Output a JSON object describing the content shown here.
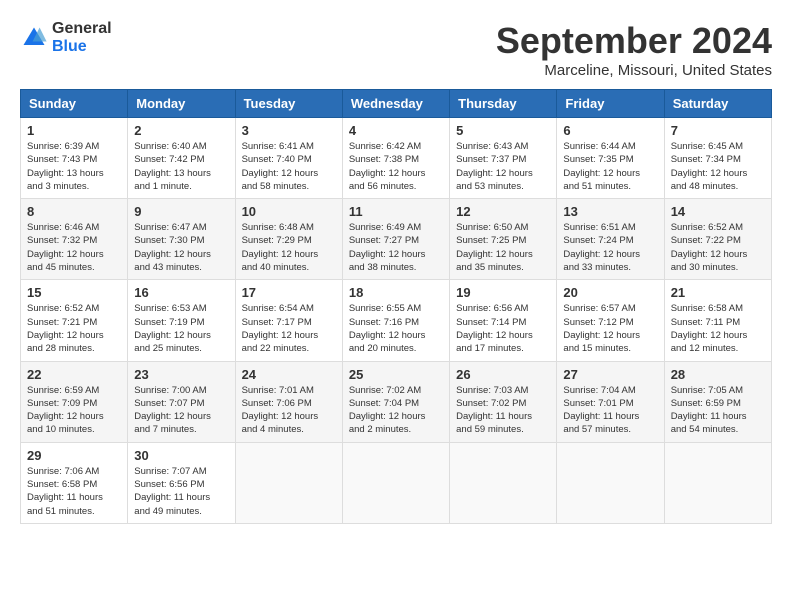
{
  "header": {
    "logo_general": "General",
    "logo_blue": "Blue",
    "month_title": "September 2024",
    "location": "Marceline, Missouri, United States"
  },
  "calendar": {
    "headers": [
      "Sunday",
      "Monday",
      "Tuesday",
      "Wednesday",
      "Thursday",
      "Friday",
      "Saturday"
    ],
    "weeks": [
      [
        {
          "day": "1",
          "info": "Sunrise: 6:39 AM\nSunset: 7:43 PM\nDaylight: 13 hours\nand 3 minutes."
        },
        {
          "day": "2",
          "info": "Sunrise: 6:40 AM\nSunset: 7:42 PM\nDaylight: 13 hours\nand 1 minute."
        },
        {
          "day": "3",
          "info": "Sunrise: 6:41 AM\nSunset: 7:40 PM\nDaylight: 12 hours\nand 58 minutes."
        },
        {
          "day": "4",
          "info": "Sunrise: 6:42 AM\nSunset: 7:38 PM\nDaylight: 12 hours\nand 56 minutes."
        },
        {
          "day": "5",
          "info": "Sunrise: 6:43 AM\nSunset: 7:37 PM\nDaylight: 12 hours\nand 53 minutes."
        },
        {
          "day": "6",
          "info": "Sunrise: 6:44 AM\nSunset: 7:35 PM\nDaylight: 12 hours\nand 51 minutes."
        },
        {
          "day": "7",
          "info": "Sunrise: 6:45 AM\nSunset: 7:34 PM\nDaylight: 12 hours\nand 48 minutes."
        }
      ],
      [
        {
          "day": "8",
          "info": "Sunrise: 6:46 AM\nSunset: 7:32 PM\nDaylight: 12 hours\nand 45 minutes."
        },
        {
          "day": "9",
          "info": "Sunrise: 6:47 AM\nSunset: 7:30 PM\nDaylight: 12 hours\nand 43 minutes."
        },
        {
          "day": "10",
          "info": "Sunrise: 6:48 AM\nSunset: 7:29 PM\nDaylight: 12 hours\nand 40 minutes."
        },
        {
          "day": "11",
          "info": "Sunrise: 6:49 AM\nSunset: 7:27 PM\nDaylight: 12 hours\nand 38 minutes."
        },
        {
          "day": "12",
          "info": "Sunrise: 6:50 AM\nSunset: 7:25 PM\nDaylight: 12 hours\nand 35 minutes."
        },
        {
          "day": "13",
          "info": "Sunrise: 6:51 AM\nSunset: 7:24 PM\nDaylight: 12 hours\nand 33 minutes."
        },
        {
          "day": "14",
          "info": "Sunrise: 6:52 AM\nSunset: 7:22 PM\nDaylight: 12 hours\nand 30 minutes."
        }
      ],
      [
        {
          "day": "15",
          "info": "Sunrise: 6:52 AM\nSunset: 7:21 PM\nDaylight: 12 hours\nand 28 minutes."
        },
        {
          "day": "16",
          "info": "Sunrise: 6:53 AM\nSunset: 7:19 PM\nDaylight: 12 hours\nand 25 minutes."
        },
        {
          "day": "17",
          "info": "Sunrise: 6:54 AM\nSunset: 7:17 PM\nDaylight: 12 hours\nand 22 minutes."
        },
        {
          "day": "18",
          "info": "Sunrise: 6:55 AM\nSunset: 7:16 PM\nDaylight: 12 hours\nand 20 minutes."
        },
        {
          "day": "19",
          "info": "Sunrise: 6:56 AM\nSunset: 7:14 PM\nDaylight: 12 hours\nand 17 minutes."
        },
        {
          "day": "20",
          "info": "Sunrise: 6:57 AM\nSunset: 7:12 PM\nDaylight: 12 hours\nand 15 minutes."
        },
        {
          "day": "21",
          "info": "Sunrise: 6:58 AM\nSunset: 7:11 PM\nDaylight: 12 hours\nand 12 minutes."
        }
      ],
      [
        {
          "day": "22",
          "info": "Sunrise: 6:59 AM\nSunset: 7:09 PM\nDaylight: 12 hours\nand 10 minutes."
        },
        {
          "day": "23",
          "info": "Sunrise: 7:00 AM\nSunset: 7:07 PM\nDaylight: 12 hours\nand 7 minutes."
        },
        {
          "day": "24",
          "info": "Sunrise: 7:01 AM\nSunset: 7:06 PM\nDaylight: 12 hours\nand 4 minutes."
        },
        {
          "day": "25",
          "info": "Sunrise: 7:02 AM\nSunset: 7:04 PM\nDaylight: 12 hours\nand 2 minutes."
        },
        {
          "day": "26",
          "info": "Sunrise: 7:03 AM\nSunset: 7:02 PM\nDaylight: 11 hours\nand 59 minutes."
        },
        {
          "day": "27",
          "info": "Sunrise: 7:04 AM\nSunset: 7:01 PM\nDaylight: 11 hours\nand 57 minutes."
        },
        {
          "day": "28",
          "info": "Sunrise: 7:05 AM\nSunset: 6:59 PM\nDaylight: 11 hours\nand 54 minutes."
        }
      ],
      [
        {
          "day": "29",
          "info": "Sunrise: 7:06 AM\nSunset: 6:58 PM\nDaylight: 11 hours\nand 51 minutes."
        },
        {
          "day": "30",
          "info": "Sunrise: 7:07 AM\nSunset: 6:56 PM\nDaylight: 11 hours\nand 49 minutes."
        },
        null,
        null,
        null,
        null,
        null
      ]
    ]
  }
}
